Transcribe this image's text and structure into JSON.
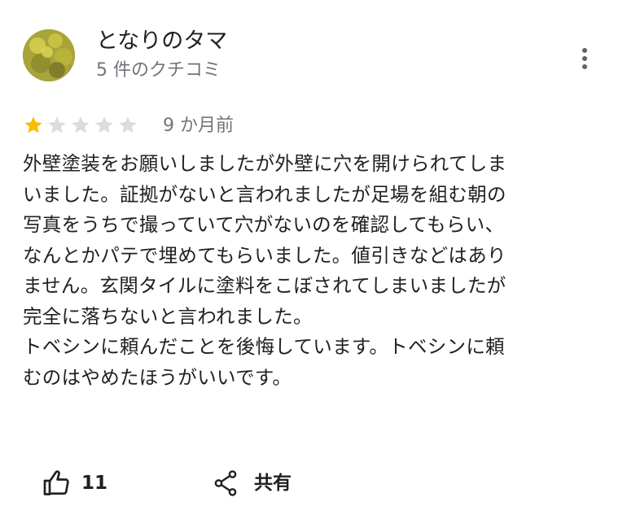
{
  "review": {
    "author": {
      "name": "となりのタマ",
      "review_count": "5 件のクチコミ",
      "avatar_icon": "avatar-photo"
    },
    "rating": 1,
    "rating_max": 5,
    "star_colors": {
      "filled": "#fbbc04",
      "empty": "#dadce0"
    },
    "date": "9 か月前",
    "lines": [
      "外壁塗装をお願いしましたが外壁に穴を開けられてしま",
      "いました。証拠がないと言われましたが足場を組む朝の",
      "写真をうちで撮っていて穴がないのを確認してもらい、",
      "なんとかパテで埋めてもらいました。値引きなどはあり",
      "ません。玄関タイルに塗料をこぼされてしまいましたが",
      "完全に落ちないと言われました。",
      "トベシンに頼んだことを後悔しています。トベシンに頼",
      "むのはやめたほうがいいです。"
    ]
  },
  "actions": {
    "like": {
      "icon": "thumb-up-icon",
      "count": "11"
    },
    "share": {
      "icon": "share-icon",
      "label": "共有"
    },
    "more": {
      "icon": "more-vert-icon"
    }
  }
}
